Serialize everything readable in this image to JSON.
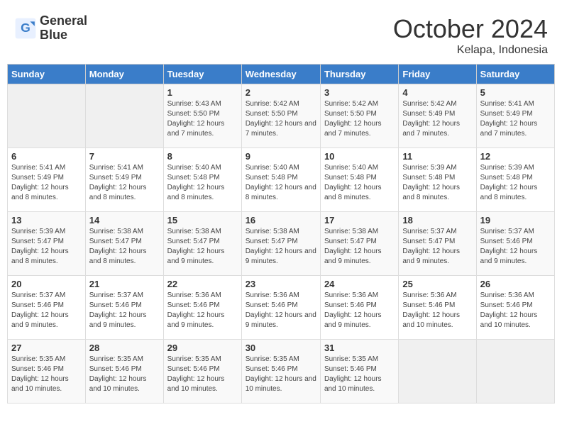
{
  "logo": {
    "line1": "General",
    "line2": "Blue"
  },
  "title": "October 2024",
  "location": "Kelapa, Indonesia",
  "days_of_week": [
    "Sunday",
    "Monday",
    "Tuesday",
    "Wednesday",
    "Thursday",
    "Friday",
    "Saturday"
  ],
  "weeks": [
    [
      {
        "num": "",
        "sunrise": "",
        "sunset": "",
        "daylight": ""
      },
      {
        "num": "",
        "sunrise": "",
        "sunset": "",
        "daylight": ""
      },
      {
        "num": "1",
        "sunrise": "Sunrise: 5:43 AM",
        "sunset": "Sunset: 5:50 PM",
        "daylight": "Daylight: 12 hours and 7 minutes."
      },
      {
        "num": "2",
        "sunrise": "Sunrise: 5:42 AM",
        "sunset": "Sunset: 5:50 PM",
        "daylight": "Daylight: 12 hours and 7 minutes."
      },
      {
        "num": "3",
        "sunrise": "Sunrise: 5:42 AM",
        "sunset": "Sunset: 5:50 PM",
        "daylight": "Daylight: 12 hours and 7 minutes."
      },
      {
        "num": "4",
        "sunrise": "Sunrise: 5:42 AM",
        "sunset": "Sunset: 5:49 PM",
        "daylight": "Daylight: 12 hours and 7 minutes."
      },
      {
        "num": "5",
        "sunrise": "Sunrise: 5:41 AM",
        "sunset": "Sunset: 5:49 PM",
        "daylight": "Daylight: 12 hours and 7 minutes."
      }
    ],
    [
      {
        "num": "6",
        "sunrise": "Sunrise: 5:41 AM",
        "sunset": "Sunset: 5:49 PM",
        "daylight": "Daylight: 12 hours and 8 minutes."
      },
      {
        "num": "7",
        "sunrise": "Sunrise: 5:41 AM",
        "sunset": "Sunset: 5:49 PM",
        "daylight": "Daylight: 12 hours and 8 minutes."
      },
      {
        "num": "8",
        "sunrise": "Sunrise: 5:40 AM",
        "sunset": "Sunset: 5:48 PM",
        "daylight": "Daylight: 12 hours and 8 minutes."
      },
      {
        "num": "9",
        "sunrise": "Sunrise: 5:40 AM",
        "sunset": "Sunset: 5:48 PM",
        "daylight": "Daylight: 12 hours and 8 minutes."
      },
      {
        "num": "10",
        "sunrise": "Sunrise: 5:40 AM",
        "sunset": "Sunset: 5:48 PM",
        "daylight": "Daylight: 12 hours and 8 minutes."
      },
      {
        "num": "11",
        "sunrise": "Sunrise: 5:39 AM",
        "sunset": "Sunset: 5:48 PM",
        "daylight": "Daylight: 12 hours and 8 minutes."
      },
      {
        "num": "12",
        "sunrise": "Sunrise: 5:39 AM",
        "sunset": "Sunset: 5:48 PM",
        "daylight": "Daylight: 12 hours and 8 minutes."
      }
    ],
    [
      {
        "num": "13",
        "sunrise": "Sunrise: 5:39 AM",
        "sunset": "Sunset: 5:47 PM",
        "daylight": "Daylight: 12 hours and 8 minutes."
      },
      {
        "num": "14",
        "sunrise": "Sunrise: 5:38 AM",
        "sunset": "Sunset: 5:47 PM",
        "daylight": "Daylight: 12 hours and 8 minutes."
      },
      {
        "num": "15",
        "sunrise": "Sunrise: 5:38 AM",
        "sunset": "Sunset: 5:47 PM",
        "daylight": "Daylight: 12 hours and 9 minutes."
      },
      {
        "num": "16",
        "sunrise": "Sunrise: 5:38 AM",
        "sunset": "Sunset: 5:47 PM",
        "daylight": "Daylight: 12 hours and 9 minutes."
      },
      {
        "num": "17",
        "sunrise": "Sunrise: 5:38 AM",
        "sunset": "Sunset: 5:47 PM",
        "daylight": "Daylight: 12 hours and 9 minutes."
      },
      {
        "num": "18",
        "sunrise": "Sunrise: 5:37 AM",
        "sunset": "Sunset: 5:47 PM",
        "daylight": "Daylight: 12 hours and 9 minutes."
      },
      {
        "num": "19",
        "sunrise": "Sunrise: 5:37 AM",
        "sunset": "Sunset: 5:46 PM",
        "daylight": "Daylight: 12 hours and 9 minutes."
      }
    ],
    [
      {
        "num": "20",
        "sunrise": "Sunrise: 5:37 AM",
        "sunset": "Sunset: 5:46 PM",
        "daylight": "Daylight: 12 hours and 9 minutes."
      },
      {
        "num": "21",
        "sunrise": "Sunrise: 5:37 AM",
        "sunset": "Sunset: 5:46 PM",
        "daylight": "Daylight: 12 hours and 9 minutes."
      },
      {
        "num": "22",
        "sunrise": "Sunrise: 5:36 AM",
        "sunset": "Sunset: 5:46 PM",
        "daylight": "Daylight: 12 hours and 9 minutes."
      },
      {
        "num": "23",
        "sunrise": "Sunrise: 5:36 AM",
        "sunset": "Sunset: 5:46 PM",
        "daylight": "Daylight: 12 hours and 9 minutes."
      },
      {
        "num": "24",
        "sunrise": "Sunrise: 5:36 AM",
        "sunset": "Sunset: 5:46 PM",
        "daylight": "Daylight: 12 hours and 9 minutes."
      },
      {
        "num": "25",
        "sunrise": "Sunrise: 5:36 AM",
        "sunset": "Sunset: 5:46 PM",
        "daylight": "Daylight: 12 hours and 10 minutes."
      },
      {
        "num": "26",
        "sunrise": "Sunrise: 5:36 AM",
        "sunset": "Sunset: 5:46 PM",
        "daylight": "Daylight: 12 hours and 10 minutes."
      }
    ],
    [
      {
        "num": "27",
        "sunrise": "Sunrise: 5:35 AM",
        "sunset": "Sunset: 5:46 PM",
        "daylight": "Daylight: 12 hours and 10 minutes."
      },
      {
        "num": "28",
        "sunrise": "Sunrise: 5:35 AM",
        "sunset": "Sunset: 5:46 PM",
        "daylight": "Daylight: 12 hours and 10 minutes."
      },
      {
        "num": "29",
        "sunrise": "Sunrise: 5:35 AM",
        "sunset": "Sunset: 5:46 PM",
        "daylight": "Daylight: 12 hours and 10 minutes."
      },
      {
        "num": "30",
        "sunrise": "Sunrise: 5:35 AM",
        "sunset": "Sunset: 5:46 PM",
        "daylight": "Daylight: 12 hours and 10 minutes."
      },
      {
        "num": "31",
        "sunrise": "Sunrise: 5:35 AM",
        "sunset": "Sunset: 5:46 PM",
        "daylight": "Daylight: 12 hours and 10 minutes."
      },
      {
        "num": "",
        "sunrise": "",
        "sunset": "",
        "daylight": ""
      },
      {
        "num": "",
        "sunrise": "",
        "sunset": "",
        "daylight": ""
      }
    ]
  ]
}
